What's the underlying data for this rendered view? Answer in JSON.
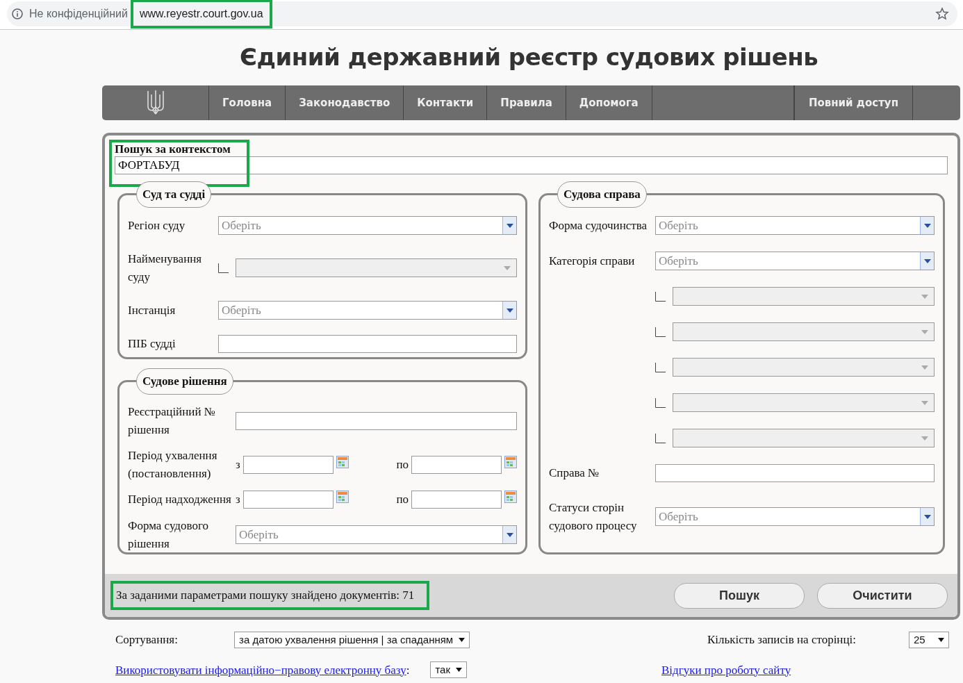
{
  "browser": {
    "security": "Не конфіденційний",
    "url": "www.reyestr.court.gov.ua",
    "url_highlighted": true
  },
  "title": "Єдиний державний реєстр судових рішень",
  "nav": {
    "items": [
      {
        "label": "Головна"
      },
      {
        "label": "Законодавство"
      },
      {
        "label": "Контакти"
      },
      {
        "label": "Правила"
      },
      {
        "label": "Допомога"
      }
    ],
    "right_items": [
      {
        "label": "Повний доступ"
      }
    ]
  },
  "context_search": {
    "label": "Пошук за контекстом",
    "value": "ФОРТАБУД",
    "highlighted": true
  },
  "court_group": {
    "title": "Суд та судді",
    "fields": [
      {
        "kind": "select",
        "label": "Регіон суду",
        "placeholder": "Оберіть"
      },
      {
        "kind": "subselect",
        "label": "Найменування суду"
      },
      {
        "kind": "select",
        "label": "Інстанція",
        "placeholder": "Оберіть"
      },
      {
        "kind": "text",
        "label": "ПІБ судді"
      }
    ]
  },
  "decision_group": {
    "title": "Судове рішення",
    "fields": [
      {
        "kind": "text",
        "label": "Реєстраційний № рішення"
      },
      {
        "kind": "daterange",
        "label": "Період ухвалення (постановлення)",
        "from_label": "з",
        "to_label": "по"
      },
      {
        "kind": "daterange",
        "label": "Період надходження",
        "from_label": "з",
        "to_label": "по"
      },
      {
        "kind": "select",
        "label": "Форма судового рішення",
        "placeholder": "Оберіть"
      }
    ]
  },
  "case_group": {
    "title": "Судова справа",
    "fields": [
      {
        "kind": "select",
        "label": "Форма судочинства",
        "placeholder": "Оберіть"
      },
      {
        "kind": "select",
        "label": "Категорія справи",
        "placeholder": "Оберіть"
      },
      {
        "kind": "subselect"
      },
      {
        "kind": "subselect"
      },
      {
        "kind": "subselect"
      },
      {
        "kind": "subselect"
      },
      {
        "kind": "subselect"
      },
      {
        "kind": "text",
        "label": "Справа №"
      },
      {
        "kind": "select",
        "label": "Статуси сторін судового процесу",
        "placeholder": "Оберіть"
      }
    ]
  },
  "result": {
    "text": "За заданими параметрами пошуку знайдено документів: 71",
    "highlighted": true
  },
  "buttons": [
    "Пошук",
    "Очистити"
  ],
  "options": {
    "sort_label": "Сортування:",
    "sort_value": "за датою ухвалення рішення | за спаданням",
    "per_page_label": "Кількість записів на сторінці:",
    "per_page_value": "25",
    "base_link": "Використовувати інформаційно−правову електронну базу",
    "base_colon": ":",
    "base_value": "так",
    "feedback_link": "Відгуки про роботу сайту"
  }
}
